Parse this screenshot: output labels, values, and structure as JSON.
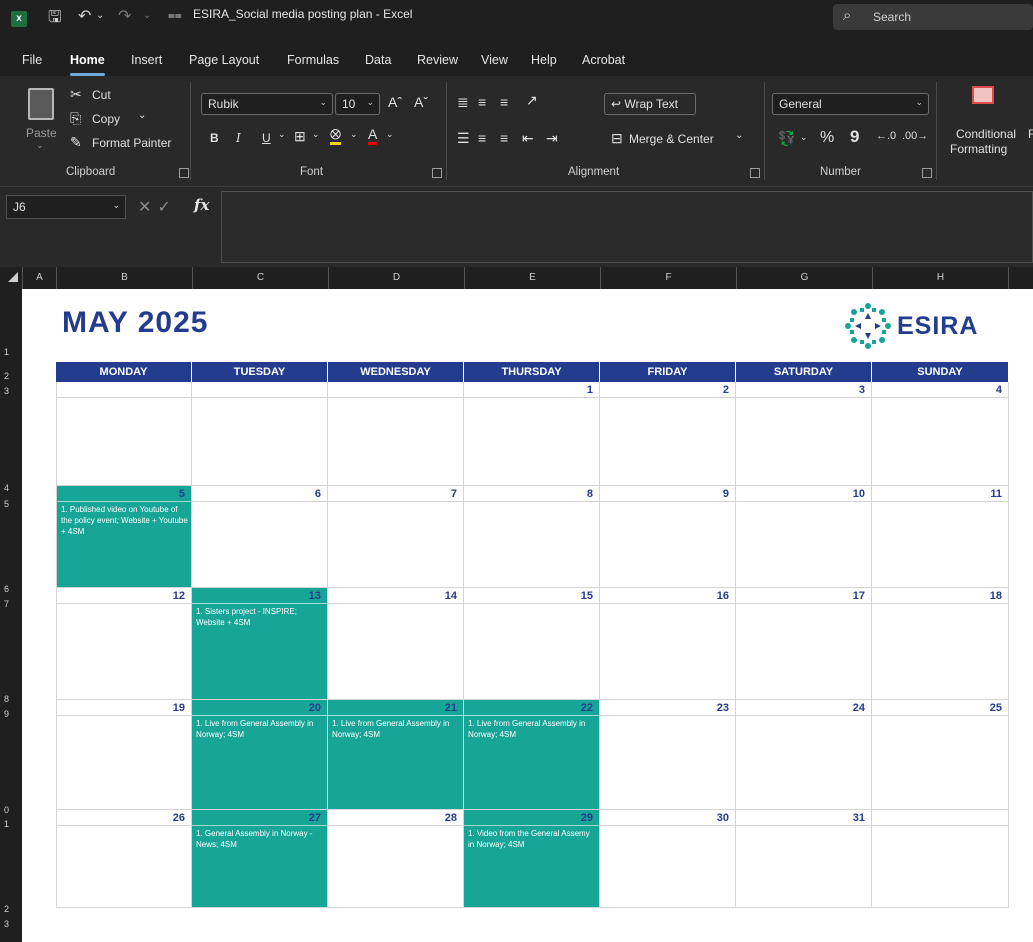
{
  "window": {
    "title": "ESIRA_Social media posting plan  -  Excel",
    "search_label": "Search"
  },
  "menu": {
    "tabs": [
      "File",
      "Home",
      "Insert",
      "Page Layout",
      "Formulas",
      "Data",
      "Review",
      "View",
      "Help",
      "Acrobat"
    ],
    "active": "Home"
  },
  "ribbon": {
    "clipboard": {
      "paste": "Paste",
      "cut": "Cut",
      "copy": "Copy",
      "format_painter": "Format Painter",
      "label": "Clipboard"
    },
    "font": {
      "name": "Rubik",
      "size": "10",
      "bold": "B",
      "italic": "I",
      "underline": "U",
      "label": "Font"
    },
    "alignment": {
      "wrap_text": "Wrap Text",
      "merge_center": "Merge & Center",
      "label": "Alignment"
    },
    "number": {
      "format": "General",
      "percent": "%",
      "comma": "9",
      "label": "Number"
    },
    "styles": {
      "conditional_line1": "Conditional",
      "conditional_line2": "Formatting",
      "extra": "F"
    }
  },
  "formula_bar": {
    "name_box": "J6",
    "fx": "fx",
    "formula": ""
  },
  "columns": [
    "A",
    "B",
    "C",
    "D",
    "E",
    "F",
    "G",
    "H"
  ],
  "rows": [
    "1",
    "2",
    "3",
    "4",
    "5",
    "6",
    "7",
    "8",
    "9",
    "0",
    "1",
    "2",
    "3"
  ],
  "calendar": {
    "title": "MAY 2025",
    "logo_text": "ESIRA",
    "days": [
      "MONDAY",
      "TUESDAY",
      "WEDNESDAY",
      "THURSDAY",
      "FRIDAY",
      "SATURDAY",
      "SUNDAY"
    ],
    "weeks": [
      [
        {
          "day": "",
          "note": "",
          "highlight": false
        },
        {
          "day": "",
          "note": "",
          "highlight": false
        },
        {
          "day": "",
          "note": "",
          "highlight": false
        },
        {
          "day": "1",
          "note": "",
          "highlight": false
        },
        {
          "day": "2",
          "note": "",
          "highlight": false
        },
        {
          "day": "3",
          "note": "",
          "highlight": false
        },
        {
          "day": "4",
          "note": "",
          "highlight": false
        }
      ],
      [
        {
          "day": "5",
          "note": "1. Published video on Youtube of the policy event; Website + Youtube + 4SM",
          "highlight": true
        },
        {
          "day": "6",
          "note": "",
          "highlight": false
        },
        {
          "day": "7",
          "note": "",
          "highlight": false
        },
        {
          "day": "8",
          "note": "",
          "highlight": false
        },
        {
          "day": "9",
          "note": "",
          "highlight": false
        },
        {
          "day": "10",
          "note": "",
          "highlight": false
        },
        {
          "day": "11",
          "note": "",
          "highlight": false
        }
      ],
      [
        {
          "day": "12",
          "note": "",
          "highlight": false
        },
        {
          "day": "13",
          "note": "1. Sisters project - INSPIRE; Website + 4SM",
          "highlight": true
        },
        {
          "day": "14",
          "note": "",
          "highlight": false
        },
        {
          "day": "15",
          "note": "",
          "highlight": false
        },
        {
          "day": "16",
          "note": "",
          "highlight": false
        },
        {
          "day": "17",
          "note": "",
          "highlight": false
        },
        {
          "day": "18",
          "note": "",
          "highlight": false
        }
      ],
      [
        {
          "day": "19",
          "note": "",
          "highlight": false
        },
        {
          "day": "20",
          "note": "1. Live from General Assembly in Norway; 4SM",
          "highlight": true
        },
        {
          "day": "21",
          "note": "1. Live from General Assembly in Norway; 4SM",
          "highlight": true
        },
        {
          "day": "22",
          "note": "1. Live from General Assembly in Norway; 4SM",
          "highlight": true
        },
        {
          "day": "23",
          "note": "",
          "highlight": false
        },
        {
          "day": "24",
          "note": "",
          "highlight": false
        },
        {
          "day": "25",
          "note": "",
          "highlight": false
        }
      ],
      [
        {
          "day": "26",
          "note": "",
          "highlight": false
        },
        {
          "day": "27",
          "note": "1. General Assembly in Norway - News; 4SM",
          "highlight": true
        },
        {
          "day": "28",
          "note": "",
          "highlight": false
        },
        {
          "day": "29",
          "note": "1. Video from the General Assemy in Norway; 4SM",
          "highlight": true
        },
        {
          "day": "30",
          "note": "",
          "highlight": false
        },
        {
          "day": "31",
          "note": "",
          "highlight": false
        },
        {
          "day": "",
          "note": "",
          "highlight": false
        }
      ]
    ]
  },
  "colors": {
    "brand_navy": "#243c8e",
    "highlight_teal": "#17a597",
    "excel_green": "#1d6f42"
  }
}
